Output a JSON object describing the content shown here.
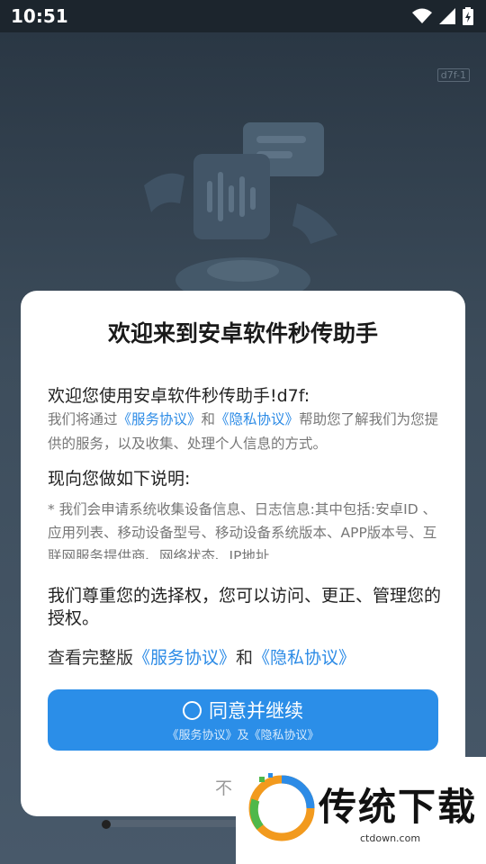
{
  "status_bar": {
    "time": "10:51"
  },
  "background": {
    "version_tag": "d7f-1"
  },
  "dialog": {
    "title": "欢迎来到安卓软件秒传助手",
    "welcome": "欢迎您使用安卓软件秒传助手!d7f:",
    "para_pre": "我们将通过",
    "link_service": "《服务协议》",
    "para_and": "和",
    "link_privacy": "《隐私协议》",
    "para_post": "帮助您了解我们为您提供的服务，以及收集、处理个人信息的方式。",
    "explain_heading": "现向您做如下说明:",
    "scroll_text": "* 我们会申请系统收集设备信息、日志信息:其中包括:安卓ID 、应用列表、移动设备型号、移动设备系统版本、APP版本号、互联网服务提供商、网络状态、IP地址",
    "respect_text": "我们尊重您的选择权，您可以访问、更正、管理您的授权。",
    "view_full_pre": "查看完整版",
    "view_full_service": "《服务协议》",
    "view_full_and": "和",
    "view_full_privacy": "《隐私协议》",
    "agree_label": "同意并继续",
    "agree_sub": "《服务协议》及《隐私协议》",
    "disagree_label": "不"
  },
  "watermark": {
    "name": "传统下载",
    "url": "ctdown.com"
  },
  "colors": {
    "accent": "#2b8ee8",
    "link": "#2c8be6"
  }
}
